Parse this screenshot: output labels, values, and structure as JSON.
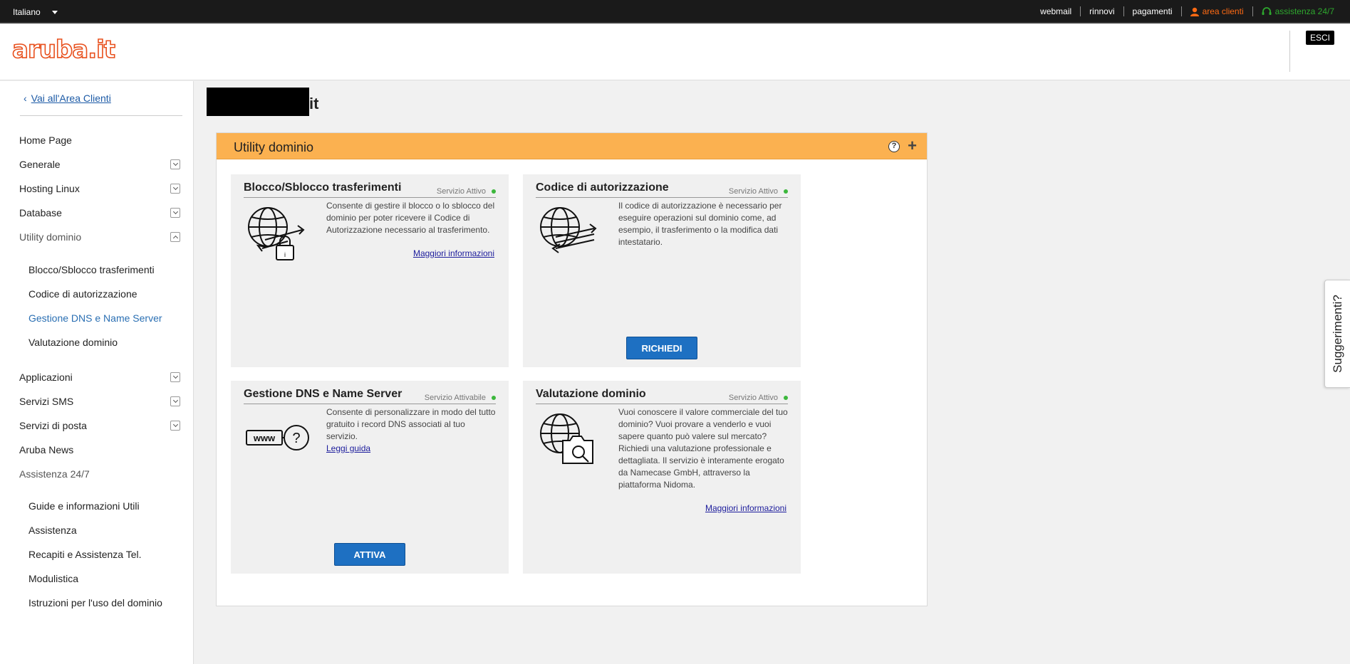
{
  "topbar": {
    "language": "Italiano",
    "links": {
      "webmail": "webmail",
      "rinnovi": "rinnovi",
      "pagamenti": "pagamenti",
      "area_clienti": "area clienti",
      "assistenza": "assistenza 24/7"
    },
    "colors": {
      "area_clienti": "#ff6a13",
      "assistenza": "#2ea82e"
    }
  },
  "header": {
    "logo": "aruba.it",
    "logout": "ESCI"
  },
  "sidebar": {
    "back_link": "Vai all'Area Clienti",
    "items": {
      "home": "Home Page",
      "generale": "Generale",
      "hosting": "Hosting Linux",
      "database": "Database",
      "utility": "Utility dominio",
      "applicazioni": "Applicazioni",
      "sms": "Servizi SMS",
      "posta": "Servizi di posta",
      "news": "Aruba News",
      "assistenza": "Assistenza 24/7"
    },
    "utility_sub": {
      "blocco": "Blocco/Sblocco trasferimenti",
      "codice": "Codice di autorizzazione",
      "dns": "Gestione DNS e Name Server",
      "valutazione": "Valutazione dominio"
    },
    "assistenza_sub": {
      "guide": "Guide e informazioni Utili",
      "assistenza": "Assistenza",
      "recapiti": "Recapiti e Assistenza Tel.",
      "modulistica": "Modulistica",
      "istruzioni": "Istruzioni per l'uso del dominio"
    }
  },
  "main": {
    "domain_suffix": "it",
    "panel_title": "Utility dominio",
    "cards": {
      "blocco": {
        "title": "Blocco/Sblocco trasferimenti",
        "status": "Servizio Attivo",
        "text": "Consente di gestire il blocco o lo sblocco del dominio per poter ricevere il Codice di Autorizzazione necessario al trasferimento.",
        "link": "Maggiori informazioni"
      },
      "codice": {
        "title": "Codice di autorizzazione",
        "status": "Servizio Attivo",
        "text": "Il codice di autorizzazione è necessario per eseguire operazioni sul dominio come, ad esempio, il trasferimento o la modifica dati intestatario.",
        "button": "RICHIEDI"
      },
      "dns": {
        "title": "Gestione DNS e Name Server",
        "status": "Servizio Attivabile",
        "text": "Consente di personalizzare in modo del tutto gratuito i record DNS associati al tuo servizio.",
        "inline_link": "Leggi guida",
        "button": "ATTIVA"
      },
      "valutazione": {
        "title": "Valutazione dominio",
        "status": "Servizio Attivo",
        "text": "Vuoi conoscere il valore commerciale del tuo dominio? Vuoi provare a venderlo e vuoi sapere quanto può valere sul mercato? Richiedi una valutazione professionale e dettagliata. Il servizio è interamente erogato da Namecase GmbH, attraverso la piattaforma Nidoma.",
        "link": "Maggiori informazioni"
      }
    }
  },
  "feedback": "Suggerimenti?"
}
